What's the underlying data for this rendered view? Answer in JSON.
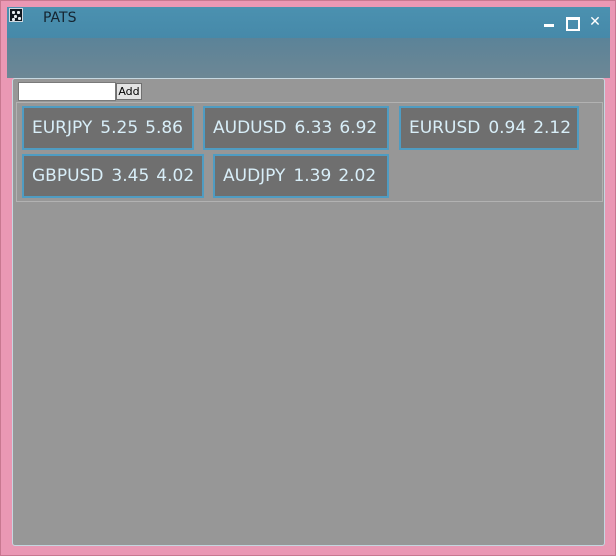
{
  "window": {
    "title": "PATS",
    "close_glyph": "✕",
    "icon": "app-icon",
    "minimize_icon": "minimize-icon",
    "maximize_icon": "maximize-icon",
    "close_icon": "close-icon"
  },
  "add_form": {
    "input_value": "",
    "add_label": "Add"
  },
  "tiles": [
    {
      "symbol": "EURJPY",
      "bid": "5.25",
      "ask": "5.86"
    },
    {
      "symbol": "AUDUSD",
      "bid": "6.33",
      "ask": "6.92"
    },
    {
      "symbol": "EURUSD",
      "bid": "0.94",
      "ask": "2.12"
    },
    {
      "symbol": "GBPUSD",
      "bid": "3.45",
      "ask": "4.02"
    },
    {
      "symbol": "AUDJPY",
      "bid": "1.39",
      "ask": "2.02"
    }
  ],
  "colors": {
    "titlebar": "#4689a9",
    "client_background": "#979797",
    "tile_background": "#6f6f6f",
    "tile_border": "#4f9cc2",
    "tile_text": "#d8eef8",
    "frame": "#ea98b4"
  }
}
